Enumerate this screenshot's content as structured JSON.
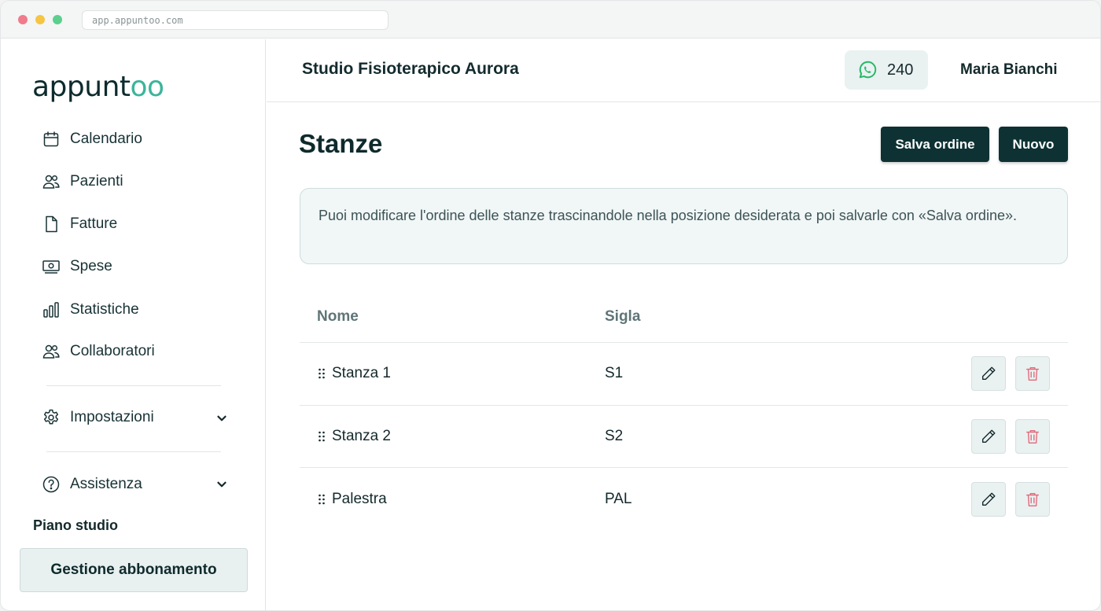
{
  "browser": {
    "url": "app.appuntoo.com"
  },
  "brand": {
    "logo_main": "appunt",
    "logo_accent": "oo"
  },
  "sidebar": {
    "items": [
      {
        "label": "Calendario",
        "icon": "calendar-icon"
      },
      {
        "label": "Pazienti",
        "icon": "users-icon"
      },
      {
        "label": "Fatture",
        "icon": "document-icon"
      },
      {
        "label": "Spese",
        "icon": "banknote-icon"
      },
      {
        "label": "Statistiche",
        "icon": "bar-chart-icon"
      },
      {
        "label": "Collaboratori",
        "icon": "users-icon"
      }
    ],
    "settings": {
      "label": "Impostazioni",
      "icon": "gear-icon"
    },
    "help": {
      "label": "Assistenza",
      "icon": "question-circle-icon"
    },
    "plan_label": "Piano studio",
    "subscription_button": "Gestione abbonamento"
  },
  "header": {
    "studio_name": "Studio Fisioterapico Aurora",
    "whatsapp_count": "240",
    "user_name": "Maria Bianchi"
  },
  "page": {
    "title": "Stanze",
    "save_order_button": "Salva ordine",
    "new_button": "Nuovo",
    "info_text": "Puoi modificare l'ordine delle stanze trascinandole nella posizione desiderata e poi salvarle con «Salva ordine»."
  },
  "table": {
    "columns": [
      "Nome",
      "Sigla"
    ],
    "rows": [
      {
        "name": "Stanza 1",
        "code": "S1"
      },
      {
        "name": "Stanza 2",
        "code": "S2"
      },
      {
        "name": "Palestra",
        "code": "PAL"
      }
    ]
  },
  "colors": {
    "accent": "#3bb59a",
    "dark": "#0e3234",
    "danger": "#e06a7a",
    "whatsapp": "#25b866"
  }
}
